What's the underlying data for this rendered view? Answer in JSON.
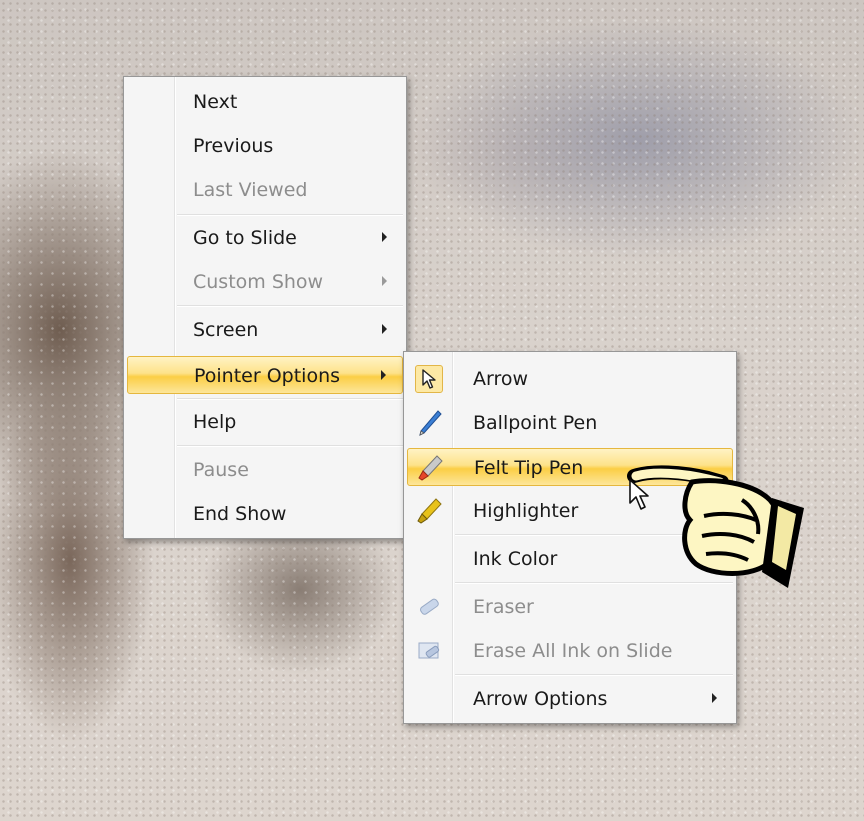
{
  "main_menu": {
    "items": [
      {
        "label": "Next"
      },
      {
        "label": "Previous"
      },
      {
        "label": "Last Viewed"
      },
      {
        "label": "Go to Slide"
      },
      {
        "label": "Custom Show"
      },
      {
        "label": "Screen"
      },
      {
        "label": "Pointer Options"
      },
      {
        "label": "Help"
      },
      {
        "label": "Pause"
      },
      {
        "label": "End Show"
      }
    ]
  },
  "pointer_submenu": {
    "items": [
      {
        "label": "Arrow",
        "icon": "arrow-pointer-icon"
      },
      {
        "label": "Ballpoint Pen",
        "icon": "ballpoint-pen-icon"
      },
      {
        "label": "Felt Tip Pen",
        "icon": "felt-tip-pen-icon"
      },
      {
        "label": "Highlighter",
        "icon": "highlighter-icon"
      },
      {
        "label": "Ink Color"
      },
      {
        "label": "Eraser",
        "icon": "eraser-icon"
      },
      {
        "label": "Erase All Ink on Slide",
        "icon": "erase-all-ink-icon"
      },
      {
        "label": "Arrow Options"
      }
    ]
  },
  "colors": {
    "highlight": "#fbce45",
    "menu_bg": "#f5f5f5",
    "disabled_text": "#8d8d8d"
  }
}
